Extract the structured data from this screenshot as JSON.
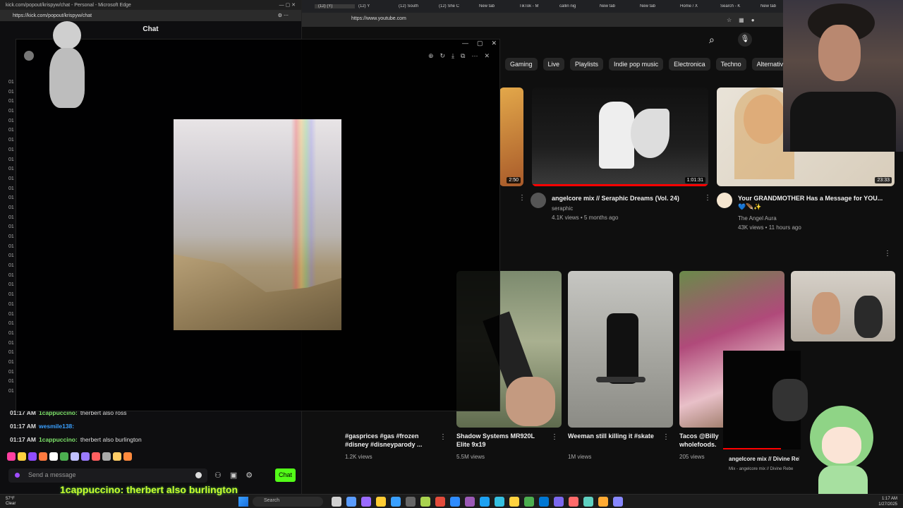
{
  "left_window": {
    "title": "kick.com/popout/krispyw/chat - Personal - Microsoft Edge",
    "url": "https://kick.com/popout/krispyw/chat",
    "chat_heading": "Chat",
    "time_stubs": [
      "01",
      "01",
      "01",
      "01",
      "01",
      "01",
      "01",
      "01",
      "01",
      "01",
      "01",
      "01",
      "01",
      "01",
      "01",
      "01",
      "01",
      "01",
      "01",
      "01",
      "01",
      "01",
      "01",
      "01",
      "01",
      "01",
      "01",
      "01",
      "01",
      "01",
      "01",
      "01",
      "01"
    ],
    "messages": [
      {
        "time": "01:17 AM",
        "user": "1cappuccino:",
        "text": "therbert also ross",
        "color": "#7ee36a"
      },
      {
        "time": "01:17 AM",
        "user": "wesmile138:",
        "text": "",
        "color": "#3aa0ff"
      },
      {
        "time": "01:17 AM",
        "user": "1cappuccino:",
        "text": "therbert also burlington",
        "color": "#7ee36a"
      }
    ],
    "emote_colors": [
      "#ff3fa0",
      "#ffd23f",
      "#8f4cff",
      "#ff7a3f",
      "#ffffff",
      "#4caf50",
      "#c0c0ff",
      "#9a7bff",
      "#ff5f5f",
      "#aaaaaa",
      "#ffcc66",
      "#ff8a3d"
    ],
    "send_placeholder": "Send a message",
    "chat_button": "Chat"
  },
  "viewer": {
    "tool_icons": [
      "zoom-icon",
      "rotate-icon",
      "download-icon",
      "open-external-icon",
      "more-icon",
      "close-icon"
    ]
  },
  "right_window": {
    "tabs": [
      "(12) (Y)",
      "(12) Y",
      "(12) South",
      "(12) She C",
      "New tab",
      "TikTok - M",
      "callin nig",
      "New tab",
      "New tab",
      "Home / X",
      "Search - K",
      "New tab"
    ],
    "url": "https://www.youtube.com",
    "chips": [
      "Gaming",
      "Live",
      "Playlists",
      "Indie pop music",
      "Electronica",
      "Techno",
      "Alternativ"
    ],
    "videos_row1": [
      {
        "title": "angelcore mix // Seraphic Dreams (Vol. 24)",
        "channel": "seraphic",
        "meta": "4.1K views • 5 months ago",
        "duration": "1:01:31"
      },
      {
        "title": "Your GRANDMOTHER Has a Message for YOU... 💙🪶✨",
        "channel": "The Angel Aura",
        "meta": "43K views • 11 hours ago",
        "duration": "23:33"
      }
    ],
    "left_partial_duration": "2:50",
    "shorts": [
      {
        "title": "#gasprices #gas #frozen #disney #disneyparody ...",
        "meta": "1.2K views"
      },
      {
        "title": "Shadow Systems MR920L Elite 9x19",
        "meta": "5.5M views"
      },
      {
        "title": "Weeman still killing it #skate",
        "meta": "1M views"
      },
      {
        "title": "Tacos @Billy wholefoods.",
        "meta": "205 views"
      }
    ],
    "mini_player": {
      "title": "angelcore mix // Divine Rebe",
      "sub": "Mix - angelcore mix // Divine Rebe"
    }
  },
  "caption": "1cappuccino: therbert also burlington",
  "taskbar": {
    "search": "Search",
    "time": "1:17 AM",
    "date": "1/27/2025",
    "weather": "57°F\nClear",
    "app_colors": [
      "#d0d0d0",
      "#5a9cff",
      "#9a6bff",
      "#ffcc33",
      "#3aa0ff",
      "#666666",
      "#a9d24f",
      "#e34b3b",
      "#2f8cff",
      "#9b59b6",
      "#1da1f2",
      "#35c0e0",
      "#ffd23f",
      "#4caf50",
      "#0078d4",
      "#7b68ee",
      "#ff6b6b",
      "#5fd0c0",
      "#ffaa33",
      "#8888ff"
    ]
  }
}
